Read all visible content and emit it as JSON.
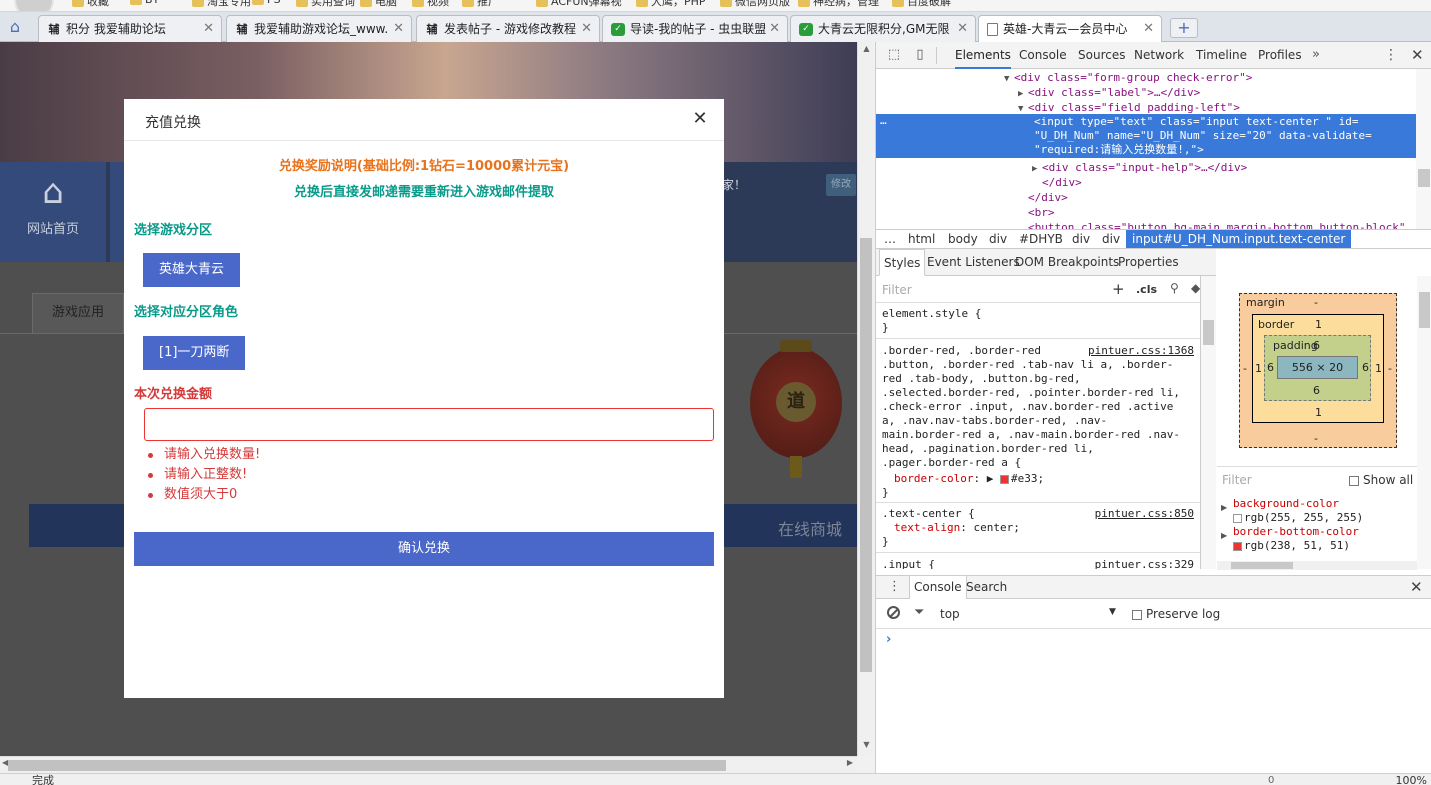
{
  "bookmarks": [
    {
      "label": "收藏"
    },
    {
      "label": "BT"
    },
    {
      "label": "淘宝专用"
    },
    {
      "label": "PS"
    },
    {
      "label": "实用查询"
    },
    {
      "label": "电脑"
    },
    {
      "label": "视频"
    },
    {
      "label": "推广"
    },
    {
      "label": "ACFUN弹幕视"
    },
    {
      "label": "大鹰，PHP"
    },
    {
      "label": "微信网页版"
    },
    {
      "label": "神经病，管理"
    },
    {
      "label": "百度破解"
    }
  ],
  "tabs": [
    {
      "icon": "辅",
      "title": "积分 我爱辅助论坛"
    },
    {
      "icon": "辅",
      "title": "我爱辅助游戏论坛_www."
    },
    {
      "icon": "辅",
      "title": "发表帖子 - 游戏修改教程"
    },
    {
      "icon": "shield",
      "title": "导读-我的帖子 - 虫虫联盟"
    },
    {
      "icon": "shield",
      "title": "大青云无限积分,GM无限"
    },
    {
      "icon": "doc",
      "title": "英雄-大青云—会员中心"
    }
  ],
  "new_tab_label": "+",
  "page": {
    "nav_home_label": "网站首页",
    "nav_user_text": "家！",
    "nav_edit_label": "修改",
    "game_tab_label": "游戏应用",
    "lantern_char": "道",
    "mall_label": "在线商城"
  },
  "modal": {
    "title": "充值兑换",
    "close_label": "✕",
    "note_line1": "兑换奖励说明(基础比例:1钻石=10000累计元宝)",
    "note_line2": "兑换后直接发邮递需要重新进入游戏邮件提取",
    "server_label": "选择游戏分区",
    "server_value": "英雄大青云",
    "role_label": "选择对应分区角色",
    "role_value": "[1]一刀两断",
    "amount_label": "本次兑换金额",
    "amount_value": "",
    "errors": [
      "请输入兑换数量!",
      "请输入正整数!",
      "数值须大于0"
    ],
    "confirm_label": "确认兑换"
  },
  "status": {
    "text": "完成",
    "zoom": "100%",
    "count": "0"
  },
  "devtools": {
    "tabs": [
      "Elements",
      "Console",
      "Sources",
      "Network",
      "Timeline",
      "Profiles"
    ],
    "more": "»",
    "dom_lines": [
      {
        "indent": 9,
        "tri": "▼",
        "html": "<div class=\"form-group check-error\">"
      },
      {
        "indent": 10,
        "tri": "▶",
        "html": "<div class=\"label\">…</div>"
      },
      {
        "indent": 10,
        "tri": "▼",
        "html": "<div class=\"field padding-left\">"
      },
      {
        "indent": 11,
        "tri": "▶",
        "html": "<div class=\"input-help\">…</div>"
      },
      {
        "indent": 11,
        "tri": "",
        "html": "</div>"
      },
      {
        "indent": 10,
        "tri": "",
        "html": "</div>"
      },
      {
        "indent": 10,
        "tri": "",
        "html": "<br>"
      },
      {
        "indent": 10,
        "tri": "",
        "html": "<button class=\"button bg-main margin-bottom button-block\""
      }
    ],
    "selected_lines": [
      "<input type=\"text\" class=\"input  text-center \" id=",
      "\"U_DH_Num\" name=\"U_DH_Num\" size=\"20\" data-validate=",
      "\"required:请输入兑换数量!,\">"
    ],
    "selected_ellipsis": "…",
    "breadcrumbs": [
      "…",
      "html",
      "body",
      "div",
      "#DHYB",
      "div",
      "div",
      "input#U_DH_Num.input.text-center"
    ],
    "style_tabs": [
      "Styles",
      "Event Listeners",
      "DOM Breakpoints",
      "Properties"
    ],
    "filter_placeholder": "Filter",
    "filter_add": "+",
    "filter_cls": ".cls",
    "element_style": [
      "element.style {",
      "}"
    ],
    "rule1_selector": [
      ".border-red, .border-red",
      ".button, .border-red .tab-nav li a, .border-",
      "red .tab-body, .button.bg-red,",
      ".selected.border-red, .pointer.border-red li,",
      ".check-error .input, .nav.border-red .active",
      "a, .nav.nav-tabs.border-red, .nav-",
      "main.border-red a, .nav-main.border-red .nav-",
      "head, .pagination.border-red li,",
      ".pager.border-red a {"
    ],
    "rule1_source": "pintuer.css:1368",
    "rule1_prop": "border-color",
    "rule1_value": "#e33;",
    "rule1_close": "}",
    "rule2_selector": ".text-center {",
    "rule2_source": "pintuer.css:850",
    "rule2_prop": "text-align",
    "rule2_value": "center;",
    "rule2_close": "}",
    "rule3_selector": ".input {",
    "rule3_source": "pintuer.css:329",
    "box": {
      "margin_label": "margin",
      "margin_top": "-",
      "margin_bottom": "-",
      "margin_left": "-",
      "margin_right": "-",
      "border_label": "border",
      "border_top": "1",
      "border_bottom": "1",
      "border_left": "1",
      "border_right": "1",
      "padding_label": "padding",
      "padding_top": "6",
      "padding_bottom": "6",
      "padding_left": "6",
      "padding_right": "6",
      "content": "556 × 20"
    },
    "computed_filter": "Filter",
    "computed_showall": "Show all",
    "computed": [
      {
        "prop": "background-color",
        "value": "rgb(255, 255, 255)",
        "color": "#ffffff"
      },
      {
        "prop": "border-bottom-color",
        "value": "rgb(238, 51, 51)",
        "color": "#ee3333"
      }
    ],
    "drawer_tabs": [
      "Console",
      "Search"
    ],
    "console_context": "top",
    "preserve_log": "Preserve log",
    "prompt": "›"
  }
}
